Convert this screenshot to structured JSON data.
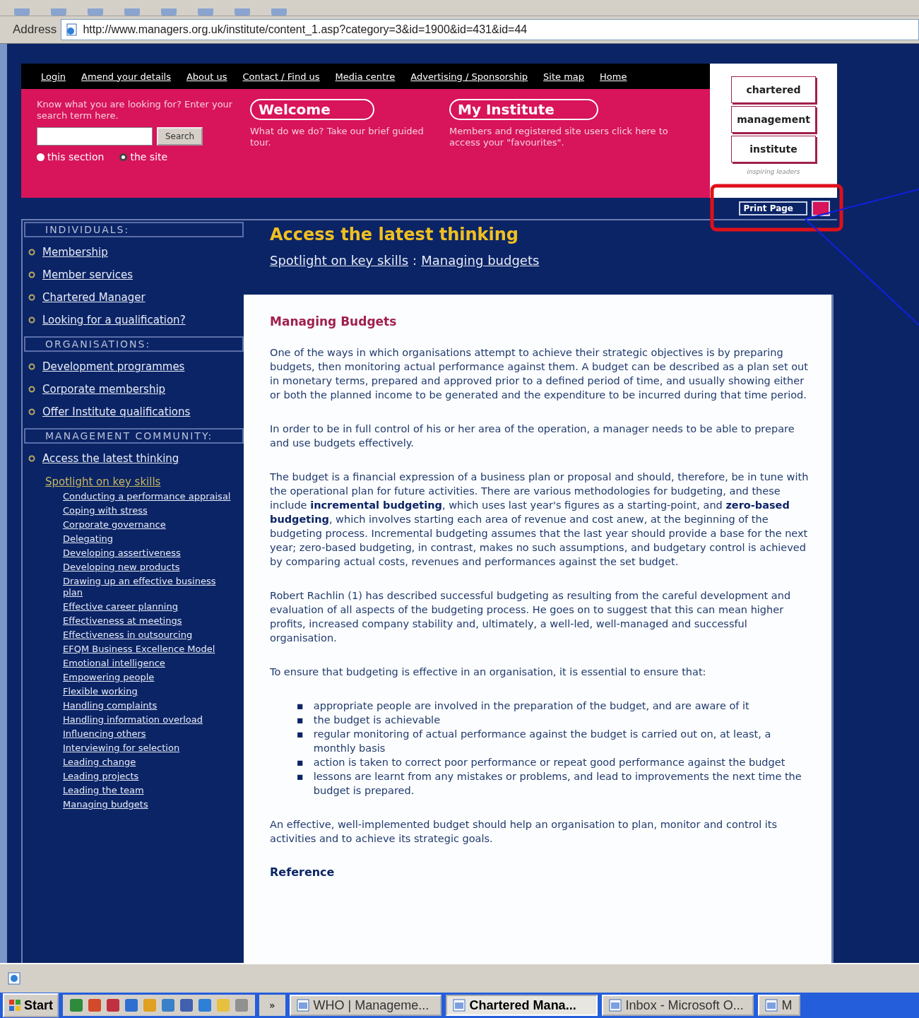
{
  "browser": {
    "address_label": "Address",
    "url": "http://www.managers.org.uk/institute/content_1.asp?category=3&id=1900&id=431&id=44"
  },
  "site_nav": [
    "Login",
    "Amend your details",
    "About us",
    "Contact / Find us",
    "Media centre",
    "Advertising / Sponsorship",
    "Site map",
    "Home"
  ],
  "search": {
    "prompt": "Know what you are looking for? Enter your search term here.",
    "button": "Search",
    "scopes": [
      {
        "label": "this section",
        "selected": false
      },
      {
        "label": "the site",
        "selected": true
      }
    ]
  },
  "promos": [
    {
      "title": "Welcome",
      "text": "What do we do? Take our brief guided tour."
    },
    {
      "title": "My Institute",
      "text": "Members and registered site users click here to access your \"favourites\"."
    }
  ],
  "logo": {
    "words": [
      "chartered",
      "management",
      "institute"
    ],
    "tagline": "inspiring leaders"
  },
  "print_button": "Print Page",
  "sidebar": [
    {
      "heading": "INDIVIDUALS:",
      "items": [
        {
          "label": "Membership",
          "selected": false
        },
        {
          "label": "Member services",
          "selected": false
        },
        {
          "label": "Chartered Manager",
          "selected": false
        },
        {
          "label": "Looking for a qualification?",
          "selected": false
        }
      ]
    },
    {
      "heading": "ORGANISATIONS:",
      "items": [
        {
          "label": "Development programmes",
          "selected": false
        },
        {
          "label": "Corporate membership",
          "selected": false
        },
        {
          "label": "Offer Institute qualifications",
          "selected": false
        }
      ]
    },
    {
      "heading": "MANAGEMENT COMMUNITY:",
      "items": [
        {
          "label": "Access the latest thinking",
          "selected": false,
          "children": [
            {
              "label": "Spotlight on key skills",
              "selected": true,
              "children": [
                {
                  "label": "Conducting a performance appraisal",
                  "selected": false
                },
                {
                  "label": "Coping with stress",
                  "selected": false
                },
                {
                  "label": "Corporate governance",
                  "selected": false
                },
                {
                  "label": "Delegating",
                  "selected": false
                },
                {
                  "label": "Developing assertiveness",
                  "selected": false
                },
                {
                  "label": "Developing new products",
                  "selected": false
                },
                {
                  "label": "Drawing up an effective business plan",
                  "selected": false
                },
                {
                  "label": "Effective career planning",
                  "selected": false
                },
                {
                  "label": "Effectiveness at meetings",
                  "selected": false
                },
                {
                  "label": "Effectiveness in outsourcing",
                  "selected": false
                },
                {
                  "label": "EFQM Business Excellence Model",
                  "selected": false
                },
                {
                  "label": "Emotional intelligence",
                  "selected": false
                },
                {
                  "label": "Empowering people",
                  "selected": false
                },
                {
                  "label": "Flexible working",
                  "selected": false
                },
                {
                  "label": "Handling complaints",
                  "selected": false
                },
                {
                  "label": "Handling information overload",
                  "selected": false
                },
                {
                  "label": "Influencing others",
                  "selected": false
                },
                {
                  "label": "Interviewing for selection",
                  "selected": false
                },
                {
                  "label": "Leading change",
                  "selected": false
                },
                {
                  "label": "Leading projects",
                  "selected": false
                },
                {
                  "label": "Leading the team",
                  "selected": false
                },
                {
                  "label": "Managing budgets",
                  "selected": false
                }
              ]
            }
          ]
        }
      ]
    }
  ],
  "page_title": "Access the latest thinking",
  "breadcrumb": {
    "links": [
      "Spotlight on key skills",
      "Managing budgets"
    ],
    "separator": ":"
  },
  "content": [
    {
      "kind": "heading",
      "text": "Managing Budgets"
    },
    {
      "kind": "paragraph",
      "text": "One of the ways in which organisations attempt to achieve their strategic objectives is by preparing budgets, then monitoring actual performance against them. A budget can be described as a plan set out in monetary terms, prepared and approved prior to a defined period of time, and usually showing either or both the planned income to be generated and the expenditure to be incurred during that time period."
    },
    {
      "kind": "paragraph",
      "text": "In order to be in full control of his or her area of the operation, a manager needs to be able to prepare and use budgets effectively."
    },
    {
      "kind": "paragraph",
      "text": "The budget is a financial expression of a business plan or proposal and should, therefore, be in tune with the operational plan for future activities. There are various methodologies for budgeting, and these include **incremental budgeting**, which uses last year's figures as a starting-point, and **zero-based budgeting**, which involves starting each area of revenue and cost anew, at the beginning of the budgeting process. Incremental budgeting assumes that the last year should provide a base for the next year; zero-based budgeting, in contrast, makes no such assumptions, and budgetary control is achieved by comparing actual costs, revenues and performances against the set budget."
    },
    {
      "kind": "paragraph",
      "text": "Robert Rachlin (1) has described successful budgeting as resulting from the careful development and evaluation of all aspects of the budgeting process. He goes on to suggest that this can mean higher profits, increased company stability and, ultimately, a well-led, well-managed and successful organisation."
    },
    {
      "kind": "paragraph",
      "text": "To ensure that budgeting is effective in an organisation, it is essential to ensure that:"
    },
    {
      "kind": "list",
      "items": [
        {
          "marker": "▪",
          "text": "appropriate people are involved in the preparation of the budget, and are aware of it"
        },
        {
          "marker": "▪",
          "text": "the budget is achievable"
        },
        {
          "marker": "▪",
          "text": "regular monitoring of actual performance against the budget is carried out on, at least, a monthly basis"
        },
        {
          "marker": "▪",
          "text": "action is taken to correct poor performance or repeat good performance against the budget"
        },
        {
          "marker": "▪",
          "text": "lessons are learnt from any mistakes or problems, and lead to improvements the next time the budget is prepared."
        }
      ]
    },
    {
      "kind": "paragraph",
      "text": "An effective, well-implemented budget should help an organisation to plan, monitor and control its activities and to achieve its strategic goals."
    },
    {
      "kind": "subheading",
      "text": "Reference"
    }
  ],
  "taskbar": {
    "start": "Start",
    "more": "»",
    "tasks": [
      {
        "label": "WHO | Manageme...",
        "selected": false
      },
      {
        "label": "Chartered Mana...",
        "selected": true
      },
      {
        "label": "Inbox - Microsoft O...",
        "selected": false
      },
      {
        "label": "M",
        "selected": false
      }
    ]
  }
}
